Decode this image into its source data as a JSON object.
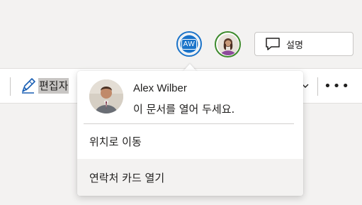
{
  "header": {
    "current_user_initials": "AW",
    "comment_button_label": "설명"
  },
  "ribbon": {
    "editor_mode_label": "편집자",
    "more_label": "•••"
  },
  "callout": {
    "person_name": "Alex Wilber",
    "person_message": "이 문서를 열어 두세요.",
    "menu": [
      {
        "label": "위치로 이동"
      },
      {
        "label": "연락처 카드 열기"
      }
    ]
  },
  "colors": {
    "accent_blue": "#1a73c9",
    "presence_green": "#3d8a2c",
    "background": "#f3f2f1"
  }
}
